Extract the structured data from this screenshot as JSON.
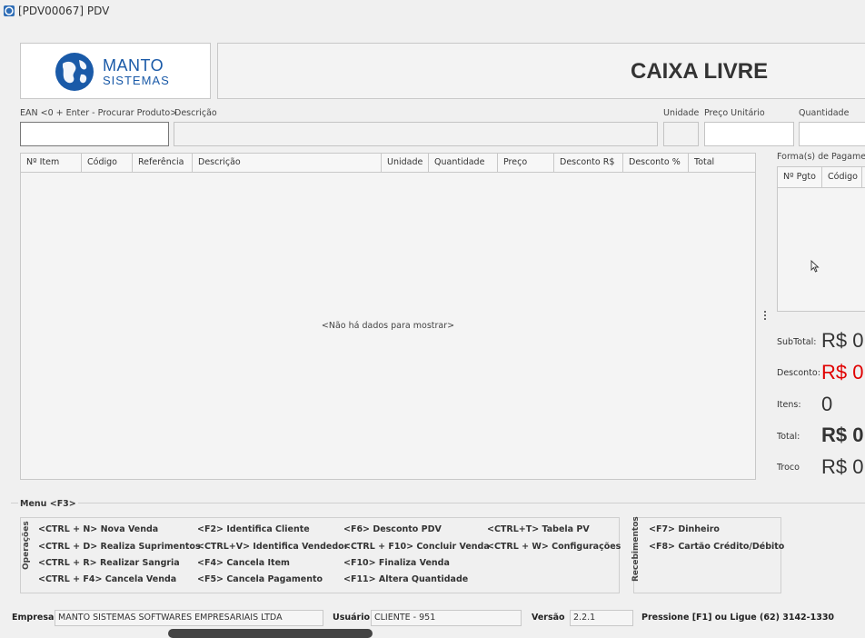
{
  "window": {
    "title": "[PDV00067] PDV"
  },
  "logo": {
    "line1": "MANTO",
    "line2": "SISTEMAS"
  },
  "status": {
    "text": "CAIXA LIVRE"
  },
  "product_fields": {
    "ean_label": "EAN <0 + Enter - Procurar Produto>",
    "descricao_label": "Descrição",
    "unidade_label": "Unidade",
    "preco_label": "Preço Unitário",
    "quantidade_label": "Quantidade",
    "ean_value": "",
    "descricao_value": "",
    "unidade_value": "",
    "preco_value": "",
    "quantidade_value": ""
  },
  "items_grid": {
    "columns": [
      "Nº Item",
      "Código",
      "Referência",
      "Descrição",
      "Unidade",
      "Quantidade",
      "Preço",
      "Desconto R$",
      "Desconto %",
      "Total"
    ],
    "empty_text": "<Não há dados para mostrar>"
  },
  "payments": {
    "label": "Forma(s) de Pagamento",
    "columns": [
      "Nº Pgto",
      "Código"
    ]
  },
  "totals": {
    "subtotal_label": "SubTotal:",
    "subtotal_value": "R$ 0",
    "desconto_label": "Desconto:",
    "desconto_value": "R$ 0",
    "itens_label": "Itens:",
    "itens_value": "0",
    "total_label": "Total:",
    "total_value": "R$ 0",
    "troco_label": "Troco",
    "troco_value": "R$ 0",
    "desconto_color": "#e00000"
  },
  "menu": {
    "title": "Menu <F3>",
    "operacoes_label": "Operações",
    "recebimentos_label": "Recebimentos",
    "shortcuts": [
      "<CTRL + N> Nova Venda",
      "<CTRL + D> Realiza Suprimentos",
      "<CTRL + R> Realizar Sangria",
      "<CTRL + F4> Cancela Venda",
      "<F2> Identifica Cliente",
      "<CTRL+V> Identifica Vendedor",
      "<F4> Cancela Item",
      "<F5> Cancela Pagamento",
      "<F6> Desconto PDV",
      "<CTRL + F10> Concluir Venda",
      "<F10> Finaliza Venda",
      "<F11> Altera Quantidade",
      "<CTRL+T> Tabela PV",
      "<CTRL + W> Configurações"
    ],
    "receb_shortcuts": [
      "<F7> Dinheiro",
      "<F8> Cartão Crédito/Débito"
    ]
  },
  "statusbar": {
    "empresa_label": "Empresa",
    "empresa_value": "MANTO SISTEMAS SOFTWARES EMPRESARIAIS LTDA",
    "usuario_label": "Usuário",
    "usuario_value": "CLIENTE - 951",
    "versao_label": "Versão",
    "versao_value": "2.2.1",
    "help_text": "Pressione [F1] ou Ligue (62) 3142-1330"
  }
}
